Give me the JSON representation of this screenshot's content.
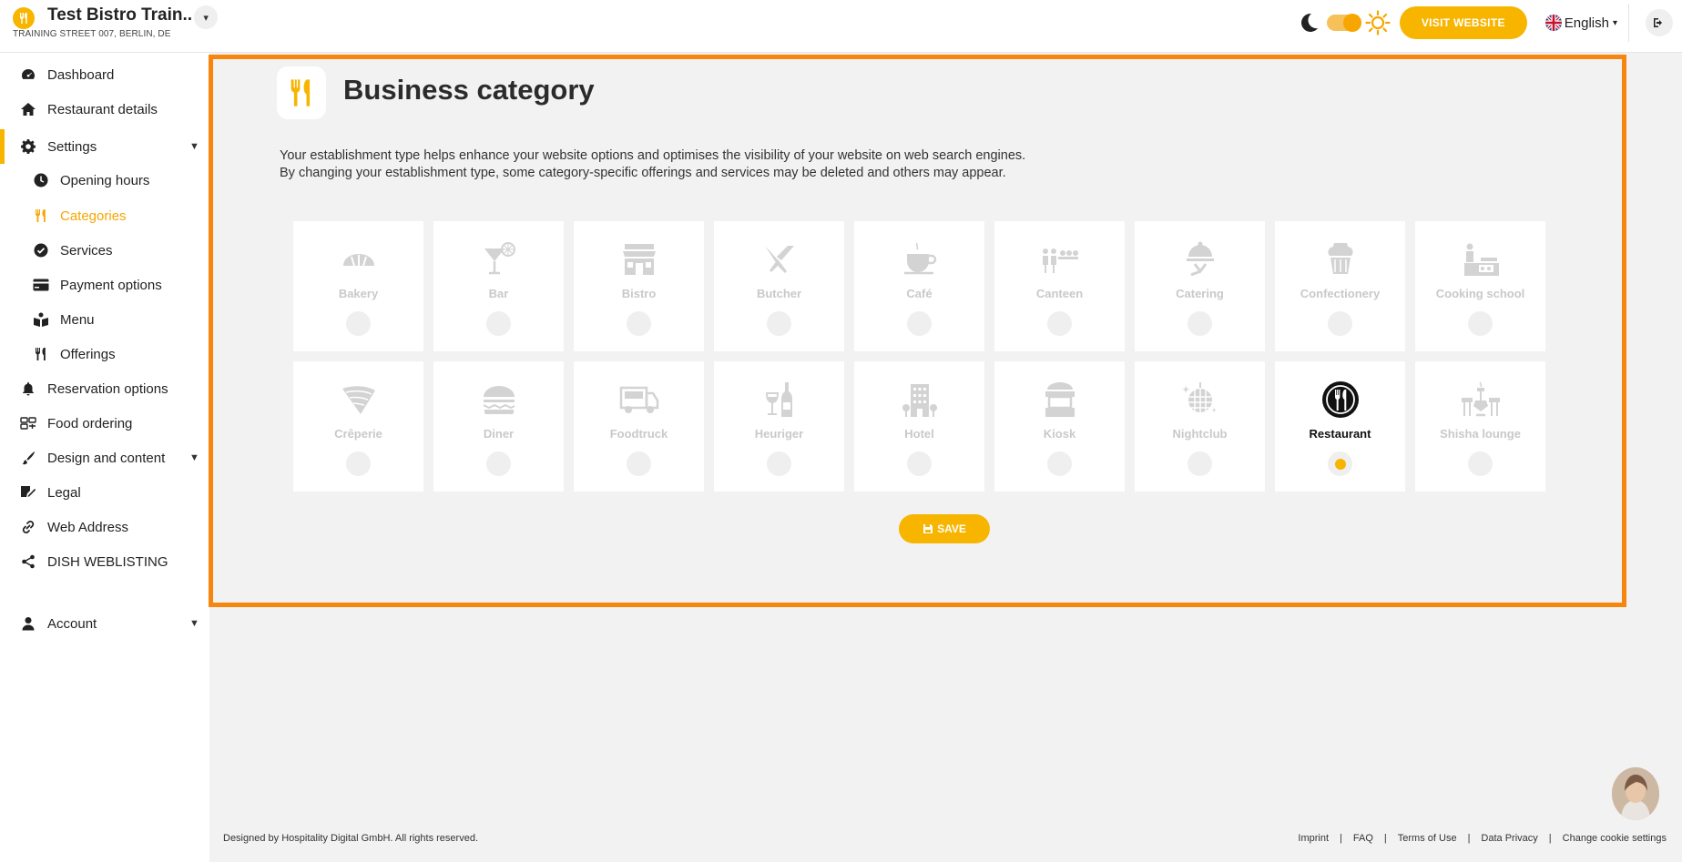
{
  "header": {
    "restaurant_name": "Test Bistro Train..",
    "address": "TRAINING STREET 007, BERLIN, DE",
    "visit_website": "VISIT WEBSITE",
    "language": "English"
  },
  "sidebar": {
    "items": [
      {
        "label": "Dashboard"
      },
      {
        "label": "Restaurant details"
      },
      {
        "label": "Settings"
      },
      {
        "label": "Opening hours"
      },
      {
        "label": "Categories"
      },
      {
        "label": "Services"
      },
      {
        "label": "Payment options"
      },
      {
        "label": "Menu"
      },
      {
        "label": "Offerings"
      },
      {
        "label": "Reservation options"
      },
      {
        "label": "Food ordering"
      },
      {
        "label": "Design and content"
      },
      {
        "label": "Legal"
      },
      {
        "label": "Web Address"
      },
      {
        "label": "DISH WEBLISTING"
      },
      {
        "label": "Account"
      }
    ]
  },
  "main": {
    "title": "Business category",
    "description_line1": "Your establishment type helps enhance your website options and optimises the visibility of your website on web search engines.",
    "description_line2": "By changing your establishment type, some category-specific offerings and services may be deleted and others may appear.",
    "categories": [
      {
        "label": "Bakery"
      },
      {
        "label": "Bar"
      },
      {
        "label": "Bistro"
      },
      {
        "label": "Butcher"
      },
      {
        "label": "Café"
      },
      {
        "label": "Canteen"
      },
      {
        "label": "Catering"
      },
      {
        "label": "Confectionery"
      },
      {
        "label": "Cooking school"
      },
      {
        "label": "Crêperie"
      },
      {
        "label": "Diner"
      },
      {
        "label": "Foodtruck"
      },
      {
        "label": "Heuriger"
      },
      {
        "label": "Hotel"
      },
      {
        "label": "Kiosk"
      },
      {
        "label": "Nightclub"
      },
      {
        "label": "Restaurant"
      },
      {
        "label": "Shisha lounge"
      }
    ],
    "selected_category": "Restaurant",
    "save_label": "SAVE"
  },
  "footer": {
    "copyright": "Designed by Hospitality Digital GmbH. All rights reserved.",
    "links": [
      "Imprint",
      "FAQ",
      "Terms of Use",
      "Data Privacy",
      "Change cookie settings"
    ]
  },
  "colors": {
    "accent": "#f7b500",
    "highlight_border": "#f7860f"
  }
}
